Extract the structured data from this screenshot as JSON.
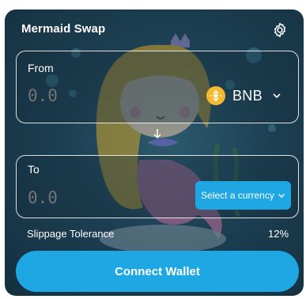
{
  "header": {
    "title": "Mermaid Swap",
    "settings_icon": "gear-icon"
  },
  "from_panel": {
    "label": "From",
    "amount": "0.0",
    "token_symbol": "BNB",
    "token_icon": "bnb-icon"
  },
  "swap_direction_icon": "arrow-down-icon",
  "to_panel": {
    "label": "To",
    "amount": "0.0",
    "select_label": "Select a currency"
  },
  "slippage": {
    "label": "Slippage Tolerance",
    "value": "12%"
  },
  "connect_button": {
    "label": "Connect Wallet"
  },
  "colors": {
    "accent": "#1fa7e4",
    "bnb": "#f3ba2f",
    "background_dark": "#14303f"
  }
}
